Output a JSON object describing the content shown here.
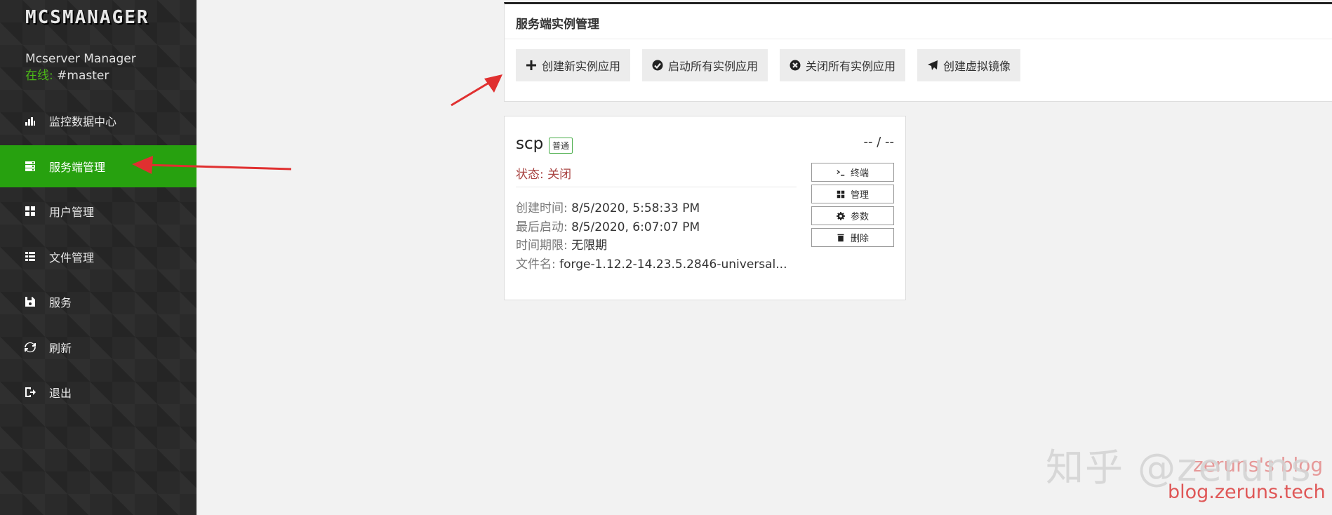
{
  "sidebar": {
    "logo": "MCSMANAGER",
    "user_name": "Mcserver Manager",
    "online_label": "在线:",
    "online_user": "#master",
    "items": [
      {
        "label": "监控数据中心",
        "icon": "bar-chart-icon"
      },
      {
        "label": "服务端管理",
        "icon": "server-icon",
        "active": true
      },
      {
        "label": "用户管理",
        "icon": "grid-icon"
      },
      {
        "label": "文件管理",
        "icon": "list-icon"
      },
      {
        "label": "服务",
        "icon": "service-icon"
      },
      {
        "label": "刷新",
        "icon": "refresh-icon"
      },
      {
        "label": "退出",
        "icon": "logout-icon"
      }
    ],
    "active_color": "#27a10f"
  },
  "panel": {
    "title": "服务端实例管理",
    "buttons": [
      {
        "label": "创建新实例应用",
        "icon": "plus-icon"
      },
      {
        "label": "启动所有实例应用",
        "icon": "check-circle-icon"
      },
      {
        "label": "关闭所有实例应用",
        "icon": "close-circle-icon"
      },
      {
        "label": "创建虚拟镜像",
        "icon": "send-icon"
      }
    ]
  },
  "instance": {
    "name": "scp",
    "badge": "普通",
    "ratio": "-- / --",
    "status": "状态: 关闭",
    "info": [
      {
        "key": "创建时间:",
        "value": "8/5/2020, 5:58:33 PM"
      },
      {
        "key": "最后启动:",
        "value": "8/5/2020, 6:07:07 PM"
      },
      {
        "key": "时间期限:",
        "value": "无限期"
      },
      {
        "key": "文件名:",
        "value": "forge-1.12.2-14.23.5.2846-universal..."
      }
    ],
    "actions": [
      {
        "label": "终端",
        "icon": "terminal-icon"
      },
      {
        "label": "管理",
        "icon": "grid-icon"
      },
      {
        "label": "参数",
        "icon": "gear-icon"
      },
      {
        "label": "删除",
        "icon": "trash-icon"
      }
    ]
  },
  "watermark": {
    "zhihu": "知乎 @zeruns",
    "blog_faded": "zeruns's blog",
    "blog_url": "blog.zeruns.tech"
  }
}
